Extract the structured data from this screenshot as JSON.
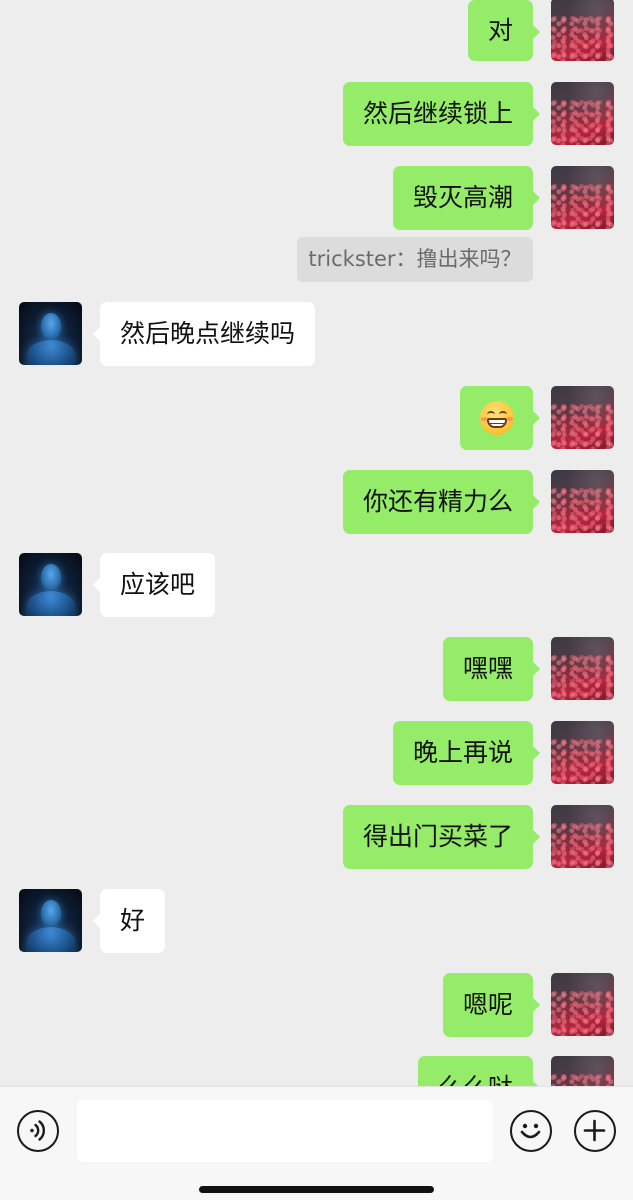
{
  "chat": {
    "messages": [
      {
        "side": "right",
        "text": "对"
      },
      {
        "side": "right",
        "text": "然后继续锁上"
      },
      {
        "side": "right",
        "text": "毁灭高潮"
      },
      {
        "side": "left",
        "text": "然后晚点继续吗"
      },
      {
        "side": "right",
        "emoji": "grinning-face-icon"
      },
      {
        "side": "right",
        "text": "你还有精力么"
      },
      {
        "side": "left",
        "text": "应该吧"
      },
      {
        "side": "right",
        "text": "嘿嘿"
      },
      {
        "side": "right",
        "text": "晚上再说"
      },
      {
        "side": "right",
        "text": "得出门买菜了"
      },
      {
        "side": "left",
        "text": "好"
      },
      {
        "side": "right",
        "text": "嗯呢"
      },
      {
        "side": "right",
        "text": "么么哒"
      }
    ],
    "system_note": "trickster：撸出来吗？"
  },
  "input_bar": {
    "voice_icon": "voice-icon",
    "emoji_icon": "emoji-icon",
    "plus_icon": "plus-icon",
    "text_value": ""
  },
  "colors": {
    "background": "#ededed",
    "sent_bubble": "#95ec69",
    "received_bubble": "#ffffff",
    "system_note_bg": "#dcdcdc"
  }
}
